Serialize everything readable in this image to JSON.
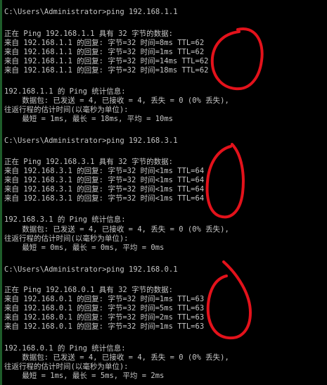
{
  "console": {
    "lines": [
      "C:\\Users\\Administrator>ping 192.168.1.1",
      "正在 Ping 192.168.1.1 具有 32 字节的数据:",
      "来自 192.168.1.1 的回复: 字节=32 时间=8ms TTL=62",
      "来自 192.168.1.1 的回复: 字节=32 时间=1ms TTL=62",
      "来自 192.168.1.1 的回复: 字节=32 时间=14ms TTL=62",
      "来自 192.168.1.1 的回复: 字节=32 时间=18ms TTL=62",
      "192.168.1.1 的 Ping 统计信息:",
      "    数据包: 已发送 = 4, 已接收 = 4, 丢失 = 0 (0% 丢失),",
      "往返行程的估计时间(以毫秒为单位):",
      "    最短 = 1ms, 最长 = 18ms, 平均 = 10ms",
      "C:\\Users\\Administrator>ping 192.168.3.1",
      "正在 Ping 192.168.3.1 具有 32 字节的数据:",
      "来自 192.168.3.1 的回复: 字节=32 时间<1ms TTL=64",
      "来自 192.168.3.1 的回复: 字节=32 时间<1ms TTL=64",
      "来自 192.168.3.1 的回复: 字节=32 时间<1ms TTL=64",
      "来自 192.168.3.1 的回复: 字节=32 时间<1ms TTL=64",
      "192.168.3.1 的 Ping 统计信息:",
      "    数据包: 已发送 = 4, 已接收 = 4, 丢失 = 0 (0% 丢失),",
      "往返行程的估计时间(以毫秒为单位):",
      "    最短 = 0ms, 最长 = 0ms, 平均 = 0ms",
      "C:\\Users\\Administrator>ping 192.168.0.1",
      "正在 Ping 192.168.0.1 具有 32 字节的数据:",
      "来自 192.168.0.1 的回复: 字节=32 时间=1ms TTL=63",
      "来自 192.168.0.1 的回复: 字节=32 时间=5ms TTL=63",
      "来自 192.168.0.1 的回复: 字节=32 时间=2ms TTL=63",
      "来自 192.168.0.1 的回复: 字节=32 时间=1ms TTL=63",
      "192.168.0.1 的 Ping 统计信息:",
      "    数据包: 已发送 = 4, 已接收 = 4, 丢失 = 0 (0% 丢失),",
      "往返行程的估计时间(以毫秒为单位):",
      "    最短 = 1ms, 最长 = 5ms, 平均 = 2ms"
    ]
  },
  "colors": {
    "background": "#000000",
    "text": "#c6c6c6",
    "annotation": "#e3121b"
  }
}
